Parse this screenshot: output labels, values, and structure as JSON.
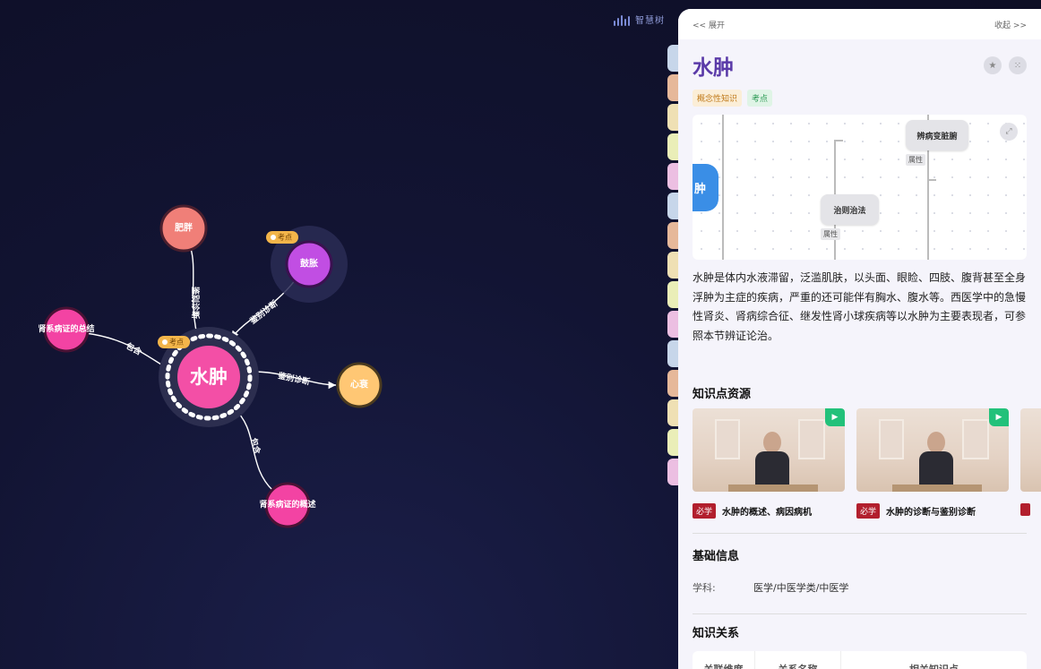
{
  "brand": {
    "logo_text": "智慧树"
  },
  "graph": {
    "center": {
      "label": "水肿",
      "color": "#f34fa6"
    },
    "nodes": [
      {
        "id": "feipang",
        "label": "肥胖",
        "color": "#f07f78"
      },
      {
        "id": "guzhang",
        "label": "鼓胀",
        "color": "#c14ee3"
      },
      {
        "id": "shenxi_zongjie",
        "label": "肾系病证的总结",
        "color": "#f343a3"
      },
      {
        "id": "xinshuai",
        "label": "心衰",
        "color": "#ffc774"
      },
      {
        "id": "shenxi_gaishu",
        "label": "肾系病证的概述",
        "color": "#f343a3"
      }
    ],
    "edges": [
      {
        "to": "feipang",
        "label": "鉴别诊断"
      },
      {
        "to": "guzhang",
        "label": "鉴别诊断"
      },
      {
        "to": "shenxi_zongjie",
        "label": "包含"
      },
      {
        "to": "xinshuai",
        "label": "鉴别诊断"
      },
      {
        "to": "shenxi_gaishu",
        "label": "包含"
      }
    ],
    "badge_label": "考点"
  },
  "panel": {
    "expand_label": "<< 展开",
    "collapse_label": "收起 >>",
    "title": "水肿",
    "tags": [
      "概念性知识",
      "考点"
    ],
    "mindmap": {
      "left_label": "肿",
      "box1": "辨病变脏腑",
      "box2": "治则治法",
      "attr": "属性"
    },
    "description": "水肿是体内水液滞留，泛滥肌肤，以头面、眼睑、四肢、腹背甚至全身浮肿为主症的疾病，严重的还可能伴有胸水、腹水等。西医学中的急慢性肾炎、肾病综合征、继发性肾小球疾病等以水肿为主要表现者，可参照本节辨证论治。",
    "resources_title": "知识点资源",
    "must_label": "必学",
    "resources": [
      {
        "title": "水肿的概述、病因病机"
      },
      {
        "title": "水肿的诊断与鉴别诊断"
      }
    ],
    "basic_info_title": "基础信息",
    "subject_key": "学科:",
    "subject_val": "医学/中医学类/中医学",
    "relations_title": "知识关系",
    "relations_headers": [
      "关联维度",
      "关系名称",
      "相关知识点"
    ]
  },
  "side_tab_colors": [
    "#c7d6ea",
    "#e6b89a",
    "#efe0b4",
    "#eaeeb8",
    "#ecbfe2",
    "#c7d6ea",
    "#e6b89a",
    "#efe0b4",
    "#eaeeb8",
    "#ecbfe2",
    "#c7d6ea",
    "#e6b89a",
    "#efe0b4",
    "#eaeeb8",
    "#ecbfe2"
  ]
}
